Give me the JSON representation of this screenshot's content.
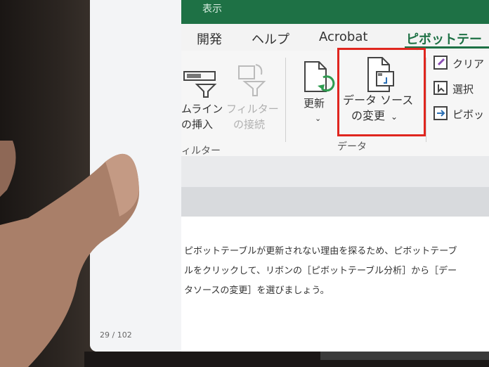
{
  "window": {
    "partial_title": "表示"
  },
  "tabs": [
    {
      "label": "開発",
      "active": false
    },
    {
      "label": "ヘルプ",
      "active": false
    },
    {
      "label": "Acrobat",
      "active": false
    },
    {
      "label": "ピボットテーブ",
      "active": true
    }
  ],
  "ribbon": {
    "timeline": {
      "line1": "ムライン",
      "line2": "の挿入"
    },
    "filter_connections": {
      "line1": "フィルター",
      "line2": "の接続"
    },
    "filter_group_label": "ィルター",
    "refresh": {
      "label": "更新"
    },
    "change_data_source": {
      "line1": "データ ソース",
      "line2": "の変更"
    },
    "data_group_label": "データ",
    "clear": {
      "label": "クリア"
    },
    "select": {
      "label": "選択"
    },
    "pivot_move": {
      "label": "ピボッ"
    }
  },
  "document": {
    "paragraph_lines": [
      "ピボットテーブルが更新されない理由を探るため、ピボットテーブ",
      "ルをクリックして、リボンの［ピボットテーブル分析］から［デー",
      "タソースの変更］を選びましょう。"
    ]
  },
  "page_indicator": "29 / 102",
  "colors": {
    "excel_green": "#1e7145",
    "highlight_red": "#e0261f"
  }
}
